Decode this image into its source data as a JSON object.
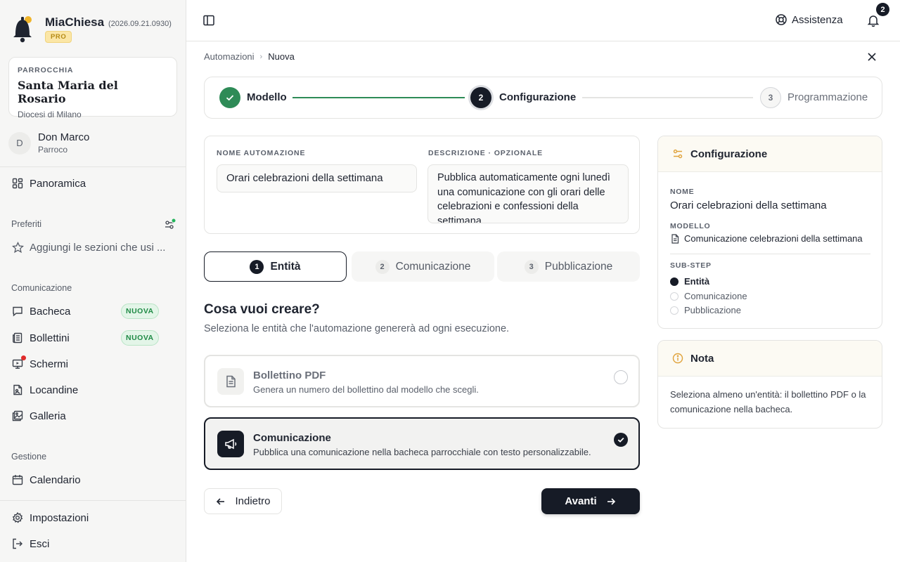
{
  "app": {
    "name": "MiaChiesa",
    "version": "(2026.09.21.0930)",
    "plan": "PRO"
  },
  "parish": {
    "kicker": "PARROCCHIA",
    "name": "Santa Maria del Rosario",
    "diocese": "Diocesi di Milano"
  },
  "user": {
    "initial": "D",
    "name": "Don Marco",
    "role": "Parroco"
  },
  "sidebar": {
    "overview": "Panoramica",
    "favorites_label": "Preferiti",
    "favorites_placeholder": "Aggiungi le sezioni che usi ...",
    "communication_label": "Comunicazione",
    "communication_items": [
      {
        "label": "Bacheca",
        "badge": "NUOVA"
      },
      {
        "label": "Bollettini",
        "badge": "NUOVA"
      },
      {
        "label": "Schermi"
      },
      {
        "label": "Locandine"
      },
      {
        "label": "Galleria"
      }
    ],
    "management_label": "Gestione",
    "calendar": "Calendario",
    "settings": "Impostazioni",
    "logout": "Esci"
  },
  "topbar": {
    "help": "Assistenza",
    "notifications_count": "2"
  },
  "breadcrumb": {
    "parent": "Automazioni",
    "current": "Nuova"
  },
  "stepper": [
    {
      "num": "1",
      "label": "Modello",
      "state": "done"
    },
    {
      "num": "2",
      "label": "Configurazione",
      "state": "active"
    },
    {
      "num": "3",
      "label": "Programmazione",
      "state": "todo"
    }
  ],
  "form": {
    "name_label": "NOME AUTOMAZIONE",
    "name_value": "Orari celebrazioni della settimana",
    "desc_label": "DESCRIZIONE · OPZIONALE",
    "desc_value": "Pubblica automaticamente ogni lunedì una comunicazione con gli orari delle celebrazioni e confessioni della settimana."
  },
  "subtabs": [
    {
      "num": "1",
      "label": "Entità",
      "active": true
    },
    {
      "num": "2",
      "label": "Comunicazione",
      "active": false
    },
    {
      "num": "3",
      "label": "Pubblicazione",
      "active": false
    }
  ],
  "question": {
    "title": "Cosa vuoi creare?",
    "subtitle": "Seleziona le entità che l'automazione genererà ad ogni esecuzione."
  },
  "options": [
    {
      "title": "Bollettino PDF",
      "desc": "Genera un numero del bollettino dal modello che scegli.",
      "selected": false,
      "icon": "document-icon"
    },
    {
      "title": "Comunicazione",
      "desc": "Pubblica una comunicazione nella bacheca parrocchiale con testo personalizzabile.",
      "selected": true,
      "icon": "megaphone-icon"
    }
  ],
  "actions": {
    "back": "Indietro",
    "next": "Avanti"
  },
  "config_panel": {
    "title": "Configurazione",
    "name_label": "NOME",
    "name_value": "Orari celebrazioni della settimana",
    "model_label": "MODELLO",
    "model_value": "Comunicazione celebrazioni della settimana",
    "substep_label": "SUB-STEP",
    "substeps": [
      "Entità",
      "Comunicazione",
      "Pubblicazione"
    ]
  },
  "note_panel": {
    "title": "Nota",
    "text": "Seleziona almeno un'entità: il bollettino PDF o la comunicazione nella bacheca."
  },
  "colors": {
    "accent_dark": "#161b26",
    "success": "#2e8b57",
    "new_badge": "#1f8a45",
    "alert": "#e02b2b",
    "pro": "#b58a14"
  }
}
